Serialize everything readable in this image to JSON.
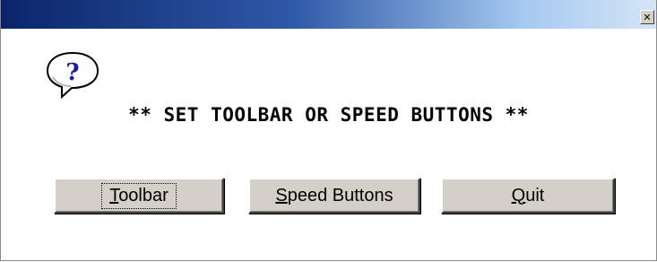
{
  "window": {
    "title": "",
    "close_glyph": "✕",
    "icon": "question-mark-balloon-icon"
  },
  "dialog": {
    "message": "** SET TOOLBAR OR SPEED BUTTONS **"
  },
  "buttons": {
    "toolbar": {
      "mnemonic": "T",
      "rest": "oolbar"
    },
    "speed": {
      "mnemonic": "S",
      "rest": "peed Buttons"
    },
    "quit": {
      "mnemonic": "Q",
      "rest": "uit"
    }
  },
  "colors": {
    "titlebar_start": "#0a246a",
    "titlebar_end": "#d4e4f6",
    "button_face": "#d4d0c8",
    "icon_text": "#1a1aa8"
  }
}
